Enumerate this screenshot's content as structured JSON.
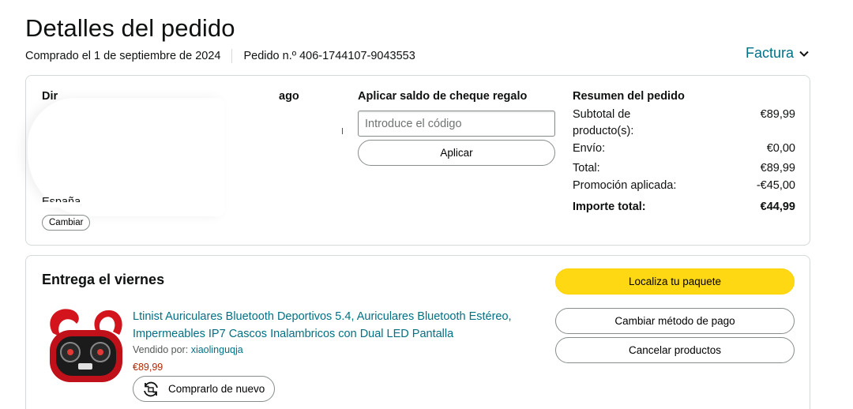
{
  "header": {
    "title": "Detalles del pedido",
    "purchase_date": "Comprado el 1 de septiembre de 2024",
    "order_number": "Pedido n.º 406-1744107-9043553",
    "invoice_label": "Factura",
    "invoice_icon": "chevron-down-icon"
  },
  "summary_card": {
    "address_heading_start": "Dir",
    "payment_heading_end": "ago",
    "country": "España",
    "change_label": "Cambiar",
    "gift": {
      "heading": "Aplicar saldo de cheque regalo",
      "placeholder": "Introduce el código",
      "apply_label": "Aplicar"
    },
    "order_summary": {
      "heading": "Resumen del pedido",
      "rows": [
        {
          "label": "Subtotal de producto(s):",
          "value": "€89,99"
        },
        {
          "label": "Envío:",
          "value": "€0,00"
        },
        {
          "label": "Total:",
          "value": "€89,99"
        },
        {
          "label": "Promoción aplicada:",
          "value": "-€45,00"
        }
      ],
      "grand_total": {
        "label": "Importe total:",
        "value": "€44,99"
      }
    }
  },
  "delivery_card": {
    "heading": "Entrega el viernes",
    "product": {
      "title": "Ltinist Auriculares Bluetooth Deportivos 5.4, Auriculares Bluetooth Estéreo, Impermeables IP7 Cascos Inalambricos con Dual LED Pantalla",
      "sold_by_label": "Vendido por:",
      "seller": "xiaolinguqja",
      "price": "€89,99",
      "buy_again_label": "Comprarlo de nuevo",
      "buy_again_icon": "buy-again-icon"
    },
    "actions": {
      "track": "Localiza tu paquete",
      "change_payment": "Cambiar método de pago",
      "cancel": "Cancelar productos"
    }
  },
  "colors": {
    "link": "#007185",
    "price": "#b12704",
    "primary_button": "#ffd814",
    "border": "#d5d9d9"
  }
}
